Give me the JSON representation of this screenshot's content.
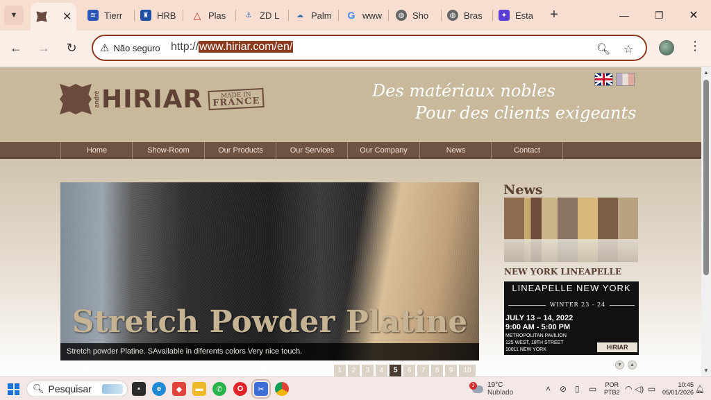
{
  "browser": {
    "tabs": [
      {
        "title": "",
        "favicon": "leather-logo-icon",
        "active": true
      },
      {
        "title": "Tierr",
        "favicon": "tier-icon"
      },
      {
        "title": "HRB",
        "favicon": "hrb-shield-icon"
      },
      {
        "title": "Plas",
        "favicon": "plas-triangle-icon"
      },
      {
        "title": "ZD L",
        "favicon": "zd-icon"
      },
      {
        "title": "Palm",
        "favicon": "palm-icon"
      },
      {
        "title": "www",
        "favicon": "google-icon"
      },
      {
        "title": "Sho",
        "favicon": "globe-icon"
      },
      {
        "title": "Bras",
        "favicon": "globe-icon"
      },
      {
        "title": "Esta",
        "favicon": "esta-icon"
      }
    ],
    "new_tab_symbol": "+",
    "security_label": "Não seguro",
    "url_prefix": "http://",
    "url_selected": "www.hiriar.com/en/"
  },
  "site": {
    "logo_text": "HIRIAR",
    "logo_sub": "andré",
    "made_in_top": "MADE IN",
    "made_in_bottom": "FRANCE",
    "tagline_line1": "Des matériaux nobles",
    "tagline_line2": "Pour des clients exigeants",
    "nav": [
      "Home",
      "Show-Room",
      "Our Products",
      "Our Services",
      "Our Company",
      "News",
      "Contact"
    ],
    "slide": {
      "title": "Stretch Powder Platine",
      "caption": "Stretch powder Platine. SAvailable in diferents colors Very nice touch."
    },
    "pager": [
      "1",
      "2",
      "3",
      "4",
      "5",
      "6",
      "7",
      "8",
      "9",
      "10"
    ],
    "pager_active": "5",
    "news": {
      "heading": "News",
      "headline": "NEW YORK LINEAPELLE",
      "card_title": "LINEAPELLE NEW YORK",
      "card_season": "WINTER 23 - 24",
      "card_dates": "JULY 13 – 14, 2022",
      "card_hours": "9:00 AM - 5:00 PM",
      "card_venue": "METROPOLITAN PAVILION",
      "card_street": "125 WEST, 18TH STREET",
      "card_city": "10011 NEW YORK",
      "card_logo": "HIRIAR"
    }
  },
  "taskbar": {
    "search_label": "Pesquisar",
    "weather_temp": "19°C",
    "weather_desc": "Nublado",
    "weather_badge": "3",
    "lang_top": "POR",
    "lang_bottom": "PTB2",
    "time": "10:45",
    "date": "05/01/2026"
  },
  "colors": {
    "accent": "#8a3a1e",
    "header_bg": "#c8b99d",
    "nav_bg": "#6e5242",
    "brand_brown": "#5e4236"
  }
}
